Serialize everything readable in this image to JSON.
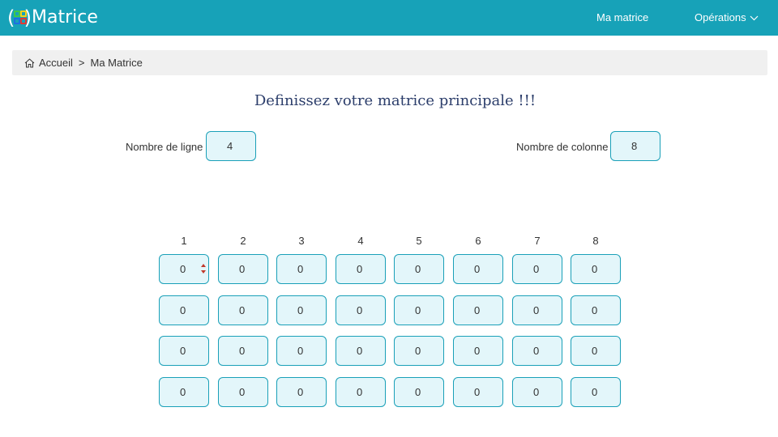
{
  "navbar": {
    "app_title": "Matrice",
    "logo_colors": [
      "#3ec84a",
      "#f2d21b",
      "#1f6fe0",
      "#e03a33"
    ],
    "links": [
      {
        "label": "Ma matrice"
      },
      {
        "label": "Opérations"
      }
    ],
    "background": "#17a2b8"
  },
  "breadcrumb": {
    "items": [
      "Accueil",
      "Ma Matrice"
    ],
    "separator": ">"
  },
  "main": {
    "heading": "Definissez votre matrice principale !!!",
    "rows_field": {
      "label": "Nombre de ligne :",
      "value": "4"
    },
    "cols_field": {
      "label": "Nombre de colonne :",
      "value": "8"
    },
    "matrix": {
      "col_headers": [
        "1",
        "2",
        "3",
        "4",
        "5",
        "6",
        "7",
        "8"
      ],
      "cells": [
        [
          "0",
          "0",
          "0",
          "0",
          "0",
          "0",
          "0",
          "0"
        ],
        [
          "0",
          "0",
          "0",
          "0",
          "0",
          "0",
          "0",
          "0"
        ],
        [
          "0",
          "0",
          "0",
          "0",
          "0",
          "0",
          "0",
          "0"
        ],
        [
          "0",
          "0",
          "0",
          "0",
          "0",
          "0",
          "0",
          "0"
        ]
      ],
      "active_cell": [
        0,
        0
      ]
    }
  },
  "icons": {
    "home": "home-icon",
    "dropdown": "chevron-down-icon",
    "spinner": "number-spinner-icon"
  }
}
